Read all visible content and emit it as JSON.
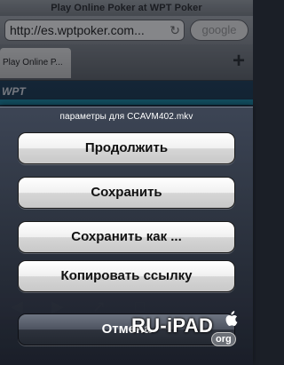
{
  "browser": {
    "title": "Play Online Poker at WPT Poker",
    "url": "http://es.wptpoker.com...",
    "search_placeholder": "google",
    "tab_label": "Play Online P...",
    "new_tab_icon": "plus-icon",
    "site_logo": "WPT"
  },
  "action_sheet": {
    "title": "параметры для CCAVM402.mkv",
    "buttons": [
      {
        "label": "Продолжить"
      },
      {
        "label": "Сохранить"
      },
      {
        "label": "Сохранить как ..."
      },
      {
        "label": "Копировать ссылку"
      }
    ],
    "cancel_label": "Отмена"
  },
  "watermark": {
    "text": "RU-iPAD",
    "suffix": "org"
  }
}
